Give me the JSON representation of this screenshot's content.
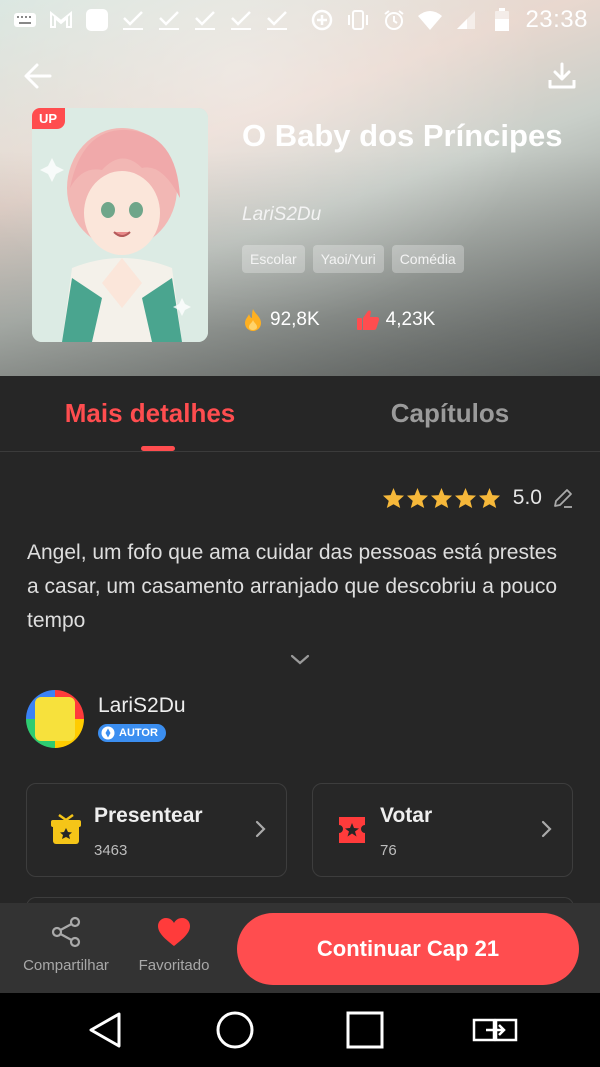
{
  "status_bar": {
    "time": "23:38",
    "icons": [
      "keyboard-icon",
      "gmail-icon",
      "app-icon",
      "check-icon",
      "check-icon",
      "check-icon",
      "check-icon",
      "check-icon",
      "data-saver-icon",
      "vibrate-icon",
      "alarm-icon",
      "wifi-icon",
      "signal-icon",
      "battery-icon"
    ]
  },
  "book": {
    "badge": "UP",
    "title": "O Baby dos Príncipes",
    "author": "LariS2Du",
    "tags": [
      "Escolar",
      "Yaoi/Yuri",
      "Comédia"
    ],
    "views": "92,8K",
    "likes": "4,23K"
  },
  "tabs": {
    "details": "Mais detalhes",
    "chapters": "Capítulos"
  },
  "rating": {
    "value": "5.0",
    "stars": 5
  },
  "description": "Angel, um fofo que ama cuidar das pessoas está prestes a casar, um casamento arranjado que descobriu a pouco tempo",
  "author_section": {
    "name": "LariS2Du",
    "badge": "AUTOR"
  },
  "cards": {
    "gift": {
      "title": "Presentear",
      "count": "3463"
    },
    "vote": {
      "title": "Votar",
      "count": "76"
    }
  },
  "bottom_bar": {
    "share": "Compartilhar",
    "favorite": "Favoritado",
    "continue": "Continuar Cap 21"
  },
  "colors": {
    "accent": "#ff4d4f",
    "star": "#f6b83a",
    "background": "#262626",
    "badge_blue": "#3b8ef0"
  }
}
